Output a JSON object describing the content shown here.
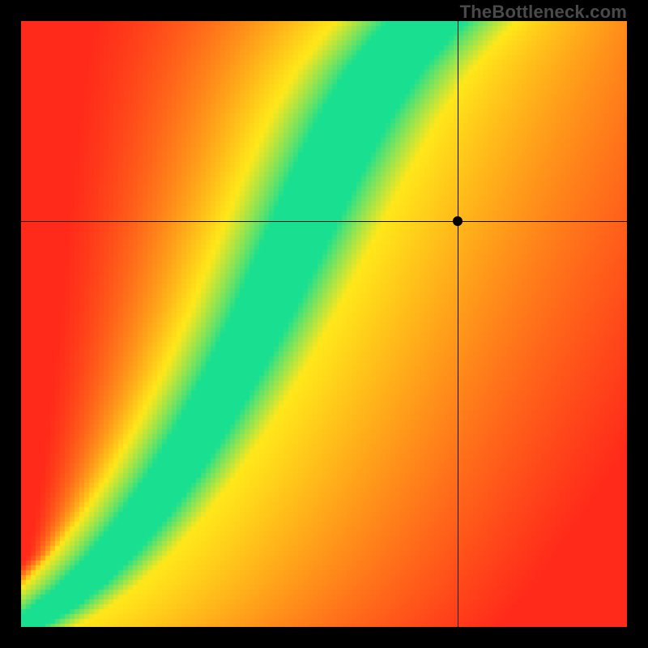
{
  "watermark": "TheBottleneck.com",
  "chart_data": {
    "type": "heatmap",
    "title": "",
    "xlabel": "",
    "ylabel": "",
    "xlim": [
      0,
      1
    ],
    "ylim": [
      0,
      1
    ],
    "legend": false,
    "grid": false,
    "color_stops": {
      "red": "#ff2a1a",
      "orange": "#ff8c1a",
      "yellow": "#ffe81a",
      "green": "#18e090"
    },
    "optimal_curve": [
      [
        0.0,
        0.0
      ],
      [
        0.05,
        0.03
      ],
      [
        0.1,
        0.07
      ],
      [
        0.15,
        0.12
      ],
      [
        0.2,
        0.18
      ],
      [
        0.25,
        0.25
      ],
      [
        0.3,
        0.33
      ],
      [
        0.35,
        0.42
      ],
      [
        0.4,
        0.52
      ],
      [
        0.45,
        0.63
      ],
      [
        0.5,
        0.74
      ],
      [
        0.55,
        0.84
      ],
      [
        0.6,
        0.92
      ],
      [
        0.65,
        0.98
      ],
      [
        0.7,
        1.03
      ]
    ],
    "marker": {
      "x": 0.72,
      "y": 0.67
    },
    "crosshair": {
      "x": 0.72,
      "y": 0.67
    }
  }
}
